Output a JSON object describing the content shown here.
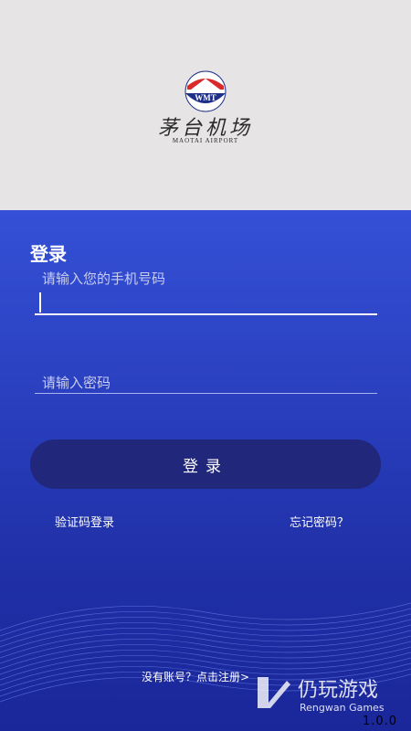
{
  "logo": {
    "cn": "茅台机场",
    "en": "MAOTAI AIRPORT",
    "badge": "WMT"
  },
  "login": {
    "title": "登录",
    "phone_placeholder": "请输入您的手机号码",
    "password_placeholder": "请输入密码",
    "button_label": "登录",
    "sms_login_link": "验证码登录",
    "forgot_password_link": "忘记密码？",
    "register_link": "没有账号？点击注册>"
  },
  "watermark": {
    "cn": "仍玩游戏",
    "en": "Rengwan Games"
  },
  "version": "1.0.0",
  "colors": {
    "top_bg": "#e6e4e5",
    "panel_bg": "#2a40c0",
    "button_bg": "#21277a"
  }
}
